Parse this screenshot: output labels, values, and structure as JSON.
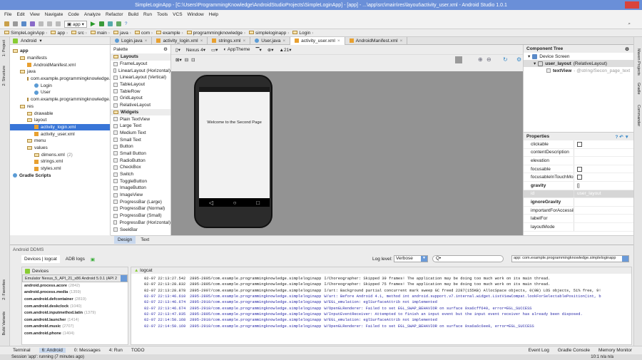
{
  "window": {
    "title": "SimpleLoginApp - [C:\\Users\\ProgrammingKnowledge\\AndroidStudioProjects\\SimpleLoginApp] - [app] - ...\\app\\src\\main\\res\\layout\\activity_user.xml - Android Studio 1.0.1"
  },
  "menu": [
    "File",
    "Edit",
    "View",
    "Navigate",
    "Code",
    "Analyze",
    "Refactor",
    "Build",
    "Run",
    "Tools",
    "VCS",
    "Window",
    "Help"
  ],
  "toolbar": {
    "run_config": "app"
  },
  "breadcrumb": [
    "SimpleLoginApp",
    "app",
    "src",
    "main",
    "java",
    "com",
    "example",
    "programmingknowledge",
    "simpleloginapp",
    "Login"
  ],
  "project": {
    "view": "Android",
    "tree": [
      {
        "label": "app",
        "depth": 0,
        "type": "folder"
      },
      {
        "label": "manifests",
        "depth": 1,
        "type": "folder"
      },
      {
        "label": "AndroidManifest.xml",
        "depth": 2,
        "type": "xml"
      },
      {
        "label": "java",
        "depth": 1,
        "type": "folder"
      },
      {
        "label": "com.example.programmingknowledge.",
        "depth": 2,
        "type": "folder"
      },
      {
        "label": "Login",
        "depth": 3,
        "type": "class"
      },
      {
        "label": "User",
        "depth": 3,
        "type": "class"
      },
      {
        "label": "com.example.programmingknowledge.",
        "depth": 2,
        "type": "folder"
      },
      {
        "label": "res",
        "depth": 1,
        "type": "folder"
      },
      {
        "label": "drawable",
        "depth": 2,
        "type": "folder"
      },
      {
        "label": "layout",
        "depth": 2,
        "type": "folder"
      },
      {
        "label": "activity_login.xml",
        "depth": 3,
        "type": "xml",
        "selected": true
      },
      {
        "label": "activity_user.xml",
        "depth": 3,
        "type": "xml"
      },
      {
        "label": "menu",
        "depth": 2,
        "type": "folder"
      },
      {
        "label": "values",
        "depth": 2,
        "type": "folder"
      },
      {
        "label": "dimens.xml",
        "depth": 3,
        "type": "folder",
        "extra": "(2)"
      },
      {
        "label": "strings.xml",
        "depth": 3,
        "type": "xml"
      },
      {
        "label": "styles.xml",
        "depth": 3,
        "type": "xml"
      },
      {
        "label": "Gradle Scripts",
        "depth": 0,
        "type": "gradle"
      }
    ]
  },
  "tabs": [
    {
      "label": "Login.java"
    },
    {
      "label": "activity_login.xml"
    },
    {
      "label": "strings.xml"
    },
    {
      "label": "User.java"
    },
    {
      "label": "activity_user.xml",
      "active": true
    },
    {
      "label": "AndroidManifest.xml"
    }
  ],
  "palette": {
    "title": "Palette",
    "items": [
      {
        "label": "Layouts",
        "group": true
      },
      {
        "label": "FrameLayout"
      },
      {
        "label": "LinearLayout (Horizontal)"
      },
      {
        "label": "LinearLayout (Vertical)"
      },
      {
        "label": "TableLayout"
      },
      {
        "label": "TableRow"
      },
      {
        "label": "GridLayout"
      },
      {
        "label": "RelativeLayout"
      },
      {
        "label": "Widgets",
        "group": true
      },
      {
        "label": "Plain TextView"
      },
      {
        "label": "Large Text"
      },
      {
        "label": "Medium Text"
      },
      {
        "label": "Small Text"
      },
      {
        "label": "Button"
      },
      {
        "label": "Small Button"
      },
      {
        "label": "RadioButton"
      },
      {
        "label": "CheckBox"
      },
      {
        "label": "Switch"
      },
      {
        "label": "ToggleButton"
      },
      {
        "label": "ImageButton"
      },
      {
        "label": "ImageView"
      },
      {
        "label": "ProgressBar (Large)"
      },
      {
        "label": "ProgressBar (Normal)"
      },
      {
        "label": "ProgressBar (Small)"
      },
      {
        "label": "ProgressBar (Horizontal)"
      },
      {
        "label": "SeekBar"
      }
    ]
  },
  "designer": {
    "device": "Nexus 4",
    "theme": "AppTheme",
    "api": "21",
    "phone_text": "Welcome to the Second Page",
    "tabs": [
      "Design",
      "Text"
    ]
  },
  "component_tree": {
    "title": "Component Tree",
    "items": [
      {
        "label": "Device Screen",
        "detail": ""
      },
      {
        "label": "user_layout",
        "detail": "(RelativeLayout)"
      },
      {
        "label": "textView",
        "detail": "- @string/Secon_page_text"
      }
    ]
  },
  "properties": {
    "title": "Properties",
    "rows": [
      {
        "name": "clickable",
        "value": "",
        "checkbox": true
      },
      {
        "name": "contentDescription",
        "value": ""
      },
      {
        "name": "elevation",
        "value": ""
      },
      {
        "name": "focusable",
        "value": "",
        "checkbox": true
      },
      {
        "name": "focusableInTouchMode",
        "value": "",
        "checkbox": true
      },
      {
        "name": "gravity",
        "value": "[]",
        "bold": true
      },
      {
        "name": "id",
        "value": "user_layout",
        "highlight": true
      },
      {
        "name": "ignoreGravity",
        "value": "",
        "bold": true
      },
      {
        "name": "importantForAccessibility",
        "value": ""
      },
      {
        "name": "labelFor",
        "value": ""
      },
      {
        "name": "layoutMode",
        "value": ""
      }
    ]
  },
  "ddms": {
    "title": "Android DDMS",
    "tabs": [
      "Devices | logcat",
      "ADB logs"
    ],
    "devices_label": "Devices",
    "emulator": "Emulator Nexus_5_API_21_x86 Android 5.0.1 (API 2",
    "processes": [
      {
        "name": "android.process.acore",
        "pid": "(2842)"
      },
      {
        "name": "android.process.media",
        "pid": "(1359)"
      },
      {
        "name": "com.android.defcontainer",
        "pid": "(2819)"
      },
      {
        "name": "com.android.deskclock",
        "pid": "(1040)"
      },
      {
        "name": "com.android.inputmethod.latin",
        "pid": "(1379)"
      },
      {
        "name": "com.android.launcher",
        "pid": "(1414)"
      },
      {
        "name": "com.android.music",
        "pid": "(2707)"
      },
      {
        "name": "com.android.phone",
        "pid": "(1404)"
      }
    ],
    "logcat_label": "logcat",
    "log_level_label": "Log level:",
    "log_level": "Verbose",
    "search_placeholder": "Q•",
    "app_filter": "app: com.example.programmingknowledge.simpleloginapp",
    "logs": [
      {
        "t": "02-07 22:13:27.542",
        "src": "2895-2895/com.example.programmingknowledge.simpleloginapp",
        "msg": "I/Choreographer: Skipped 39 frames!  The application may be doing too much work on its main thread.",
        "warn": false
      },
      {
        "t": "02-07 22:13:28.832",
        "src": "2895-2895/com.example.programmingknowledge.simpleloginapp",
        "msg": "I/Choreographer: Skipped 75 frames!  The application may be doing too much work on its main thread.",
        "warn": false
      },
      {
        "t": "02-07 22:13:28.878",
        "src": "2895-2907/com.example.programmingknowledge.simpleloginapp",
        "msg": "I/art: Background partial concurrent mark sweep GC freed 2287(155KB) AllocSpace objects, 0(0B) LOS objects, 51% free, 9!",
        "warn": false
      },
      {
        "t": "02-07 22:13:46.610",
        "src": "2895-2895/com.example.programmingknowledge.simpleloginapp",
        "msg": "W/art: Before Android 4.1, method int android.support.v7.internal.widget.ListViewCompat.lookForSelectablePosition(int, b",
        "warn": true
      },
      {
        "t": "02-07 22:13:46.674",
        "src": "2895-2910/com.example.programmingknowledge.simpleloginapp",
        "msg": "W/EGL_emulation: eglSurfaceAttrib not implemented",
        "warn": true
      },
      {
        "t": "02-07 22:13:46.674",
        "src": "2895-2910/com.example.programmingknowledge.simpleloginapp",
        "msg": "W/OpenGLRenderer: Failed to set EGL_SWAP_BEHAVIOR on surface 0xa6cff640, error=EGL_SUCCESS",
        "warn": true
      },
      {
        "t": "02-07 22:13:47.935",
        "src": "2895-2895/com.example.programmingknowledge.simpleloginapp",
        "msg": "W/InputEventReceiver: Attempted to finish an input event but the input event receiver has already been disposed.",
        "warn": true
      },
      {
        "t": "02-07 22:14:50.168",
        "src": "2895-2910/com.example.programmingknowledge.simpleloginapp",
        "msg": "W/EGL_emulation: eglSurfaceAttrib not implemented",
        "warn": true
      },
      {
        "t": "02-07 22:14:50.169",
        "src": "2895-2910/com.example.programmingknowledge.simpleloginapp",
        "msg": "W/OpenGLRenderer: Failed to set EGL_SWAP_BEHAVIOR on surface 0xa6a6c6ee0, error=EGL_SUCCESS",
        "warn": true
      }
    ]
  },
  "bottom_tabs": [
    "Terminal",
    "6: Android",
    "0: Messages",
    "4: Run",
    "TODO"
  ],
  "bottom_right_tabs": [
    "Event Log",
    "Gradle Console",
    "Memory Monitor"
  ],
  "status": {
    "text": "Session 'app': running (7 minutes ago)",
    "position": "10:1",
    "enc1": "n/a",
    "enc2": "n/a"
  },
  "side_left": [
    "1: Project",
    "2: Structure",
    "2: Favorites",
    "Build Variants"
  ],
  "side_right": [
    "Maven Projects",
    "Gradle",
    "Commander"
  ]
}
